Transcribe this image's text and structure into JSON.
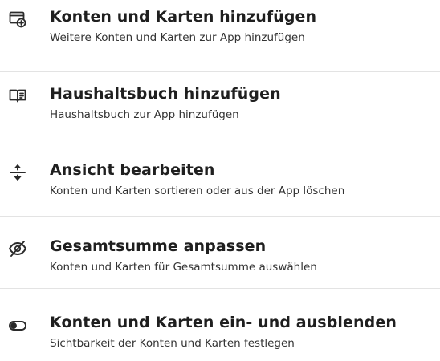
{
  "menu": {
    "items": [
      {
        "title": "Konten und Karten hinzufügen",
        "subtitle": "Weitere Konten und Karten zur App hinzufügen",
        "icon": "add-card-icon"
      },
      {
        "title": "Haushaltsbuch hinzufügen",
        "subtitle": "Haushaltsbuch zur App hinzufügen",
        "icon": "book-icon"
      },
      {
        "title": "Ansicht bearbeiten",
        "subtitle": "Konten und Karten sortieren oder aus der App löschen",
        "icon": "reorder-arrows-icon"
      },
      {
        "title": "Gesamtsumme anpassen",
        "subtitle": "Konten und Karten für Gesamtsumme auswählen",
        "icon": "eye-off-icon"
      },
      {
        "title": "Konten und Karten ein- und ausblenden",
        "subtitle": "Sichtbarkeit der Konten und Karten festlegen",
        "icon": "toggle-icon"
      }
    ]
  },
  "colors": {
    "text": "#1f1f1f",
    "subtext": "#333333",
    "divider": "#e3e3e3",
    "background": "#ffffff"
  }
}
